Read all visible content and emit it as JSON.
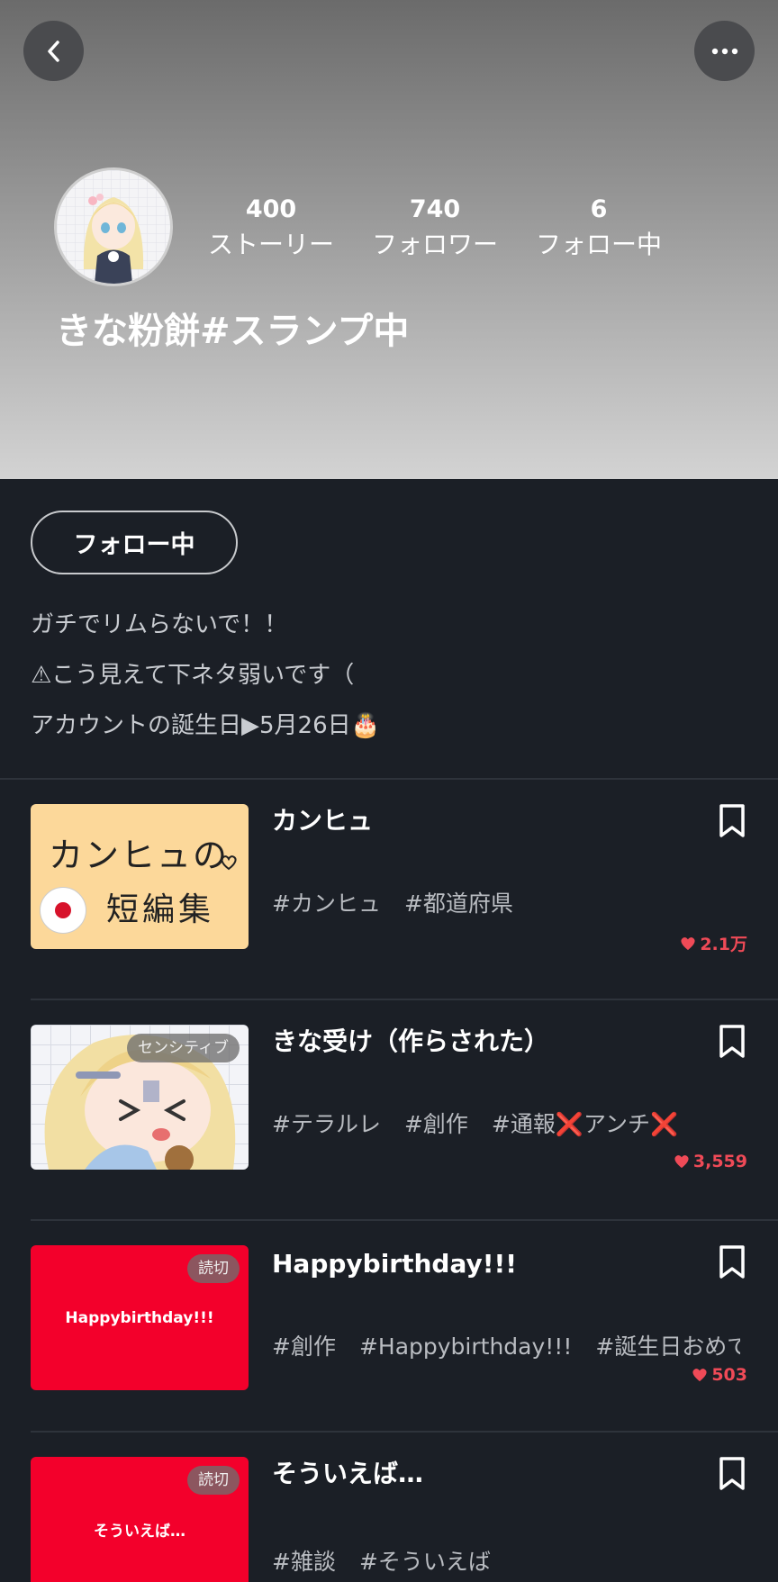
{
  "profile": {
    "username": "きな粉餅#スランプ中",
    "stats": [
      {
        "value": "400",
        "label": "ストーリー"
      },
      {
        "value": "740",
        "label": "フォロワー"
      },
      {
        "value": "6",
        "label": "フォロー中"
      }
    ],
    "follow_button": "フォロー中",
    "bio": [
      "ガチでリムらないで！！",
      "⚠こう見えて下ネタ弱いです（",
      "アカウントの誕生日▶5月26日🎂"
    ]
  },
  "stories": [
    {
      "title": "カンヒュ",
      "tags": [
        "#カンヒュ",
        "#都道府県"
      ],
      "likes": "2.1万",
      "thumb_type": "kanhyu",
      "thumb_text_1": "カンヒュの",
      "thumb_text_2": "短編集"
    },
    {
      "title": "きな受け（作らされた）",
      "tags": [
        "#テラルレ",
        "#創作",
        "#通報❌アンチ❌"
      ],
      "likes": "3,559",
      "thumb_type": "illustration",
      "badge": "センシティブ"
    },
    {
      "title": "Happybirthday!!!",
      "tags": [
        "#創作",
        "#Happybirthday!!!",
        "#誕生日おめで…"
      ],
      "likes": "503",
      "thumb_type": "red",
      "badge": "読切",
      "thumb_title": "Happybirthday!!!"
    },
    {
      "title": "そういえば…",
      "tags": [
        "#雑談",
        "#そういえば"
      ],
      "likes": "",
      "thumb_type": "red",
      "badge": "読切",
      "thumb_title": "そういえば…"
    }
  ],
  "colors": {
    "background": "#1b1f26",
    "like_red": "#ef4a57",
    "thumb_red": "#f3002b"
  }
}
